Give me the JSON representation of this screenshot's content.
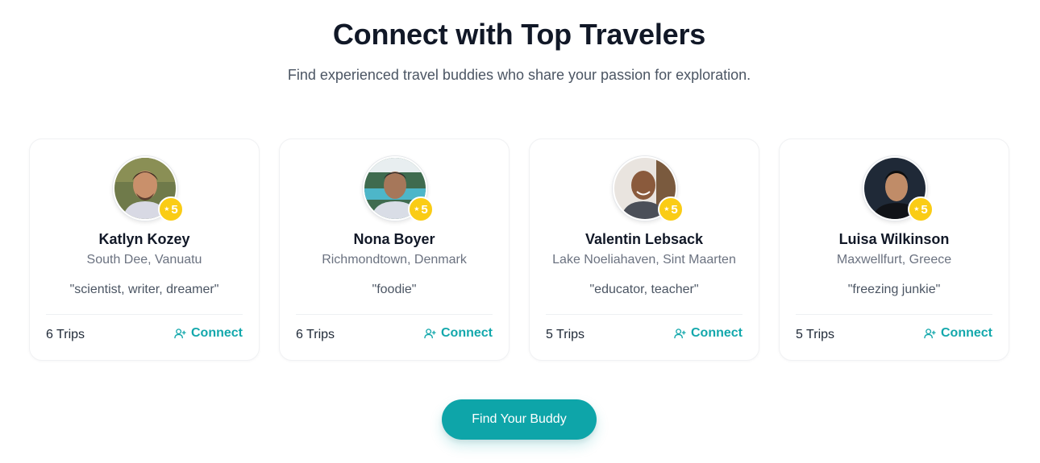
{
  "header": {
    "title": "Connect with Top Travelers",
    "subtitle": "Find experienced travel buddies who share your passion for exploration."
  },
  "colors": {
    "accent": "#0ea5a9",
    "badge": "#facc15",
    "text_primary": "#111827",
    "text_muted": "#6b7280"
  },
  "travelers": [
    {
      "name": "Katlyn Kozey",
      "location": "South Dee, Vanuatu",
      "bio": "\"scientist, writer, dreamer\"",
      "rating": "5",
      "trips": "6 Trips",
      "connect_label": "Connect",
      "avatar_icon": "avatar-photo-icon",
      "connect_icon": "user-plus-icon"
    },
    {
      "name": "Nona Boyer",
      "location": "Richmondtown, Denmark",
      "bio": "\"foodie\"",
      "rating": "5",
      "trips": "6 Trips",
      "connect_label": "Connect",
      "avatar_icon": "avatar-photo-icon",
      "connect_icon": "user-plus-icon"
    },
    {
      "name": "Valentin Lebsack",
      "location": "Lake Noeliahaven, Sint Maarten",
      "bio": "\"educator, teacher\"",
      "rating": "5",
      "trips": "5 Trips",
      "connect_label": "Connect",
      "avatar_icon": "avatar-photo-icon",
      "connect_icon": "user-plus-icon"
    },
    {
      "name": "Luisa Wilkinson",
      "location": "Maxwellfurt, Greece",
      "bio": "\"freezing junkie\"",
      "rating": "5",
      "trips": "5 Trips",
      "connect_label": "Connect",
      "avatar_icon": "avatar-photo-icon",
      "connect_icon": "user-plus-icon"
    }
  ],
  "cta": {
    "label": "Find Your Buddy"
  }
}
